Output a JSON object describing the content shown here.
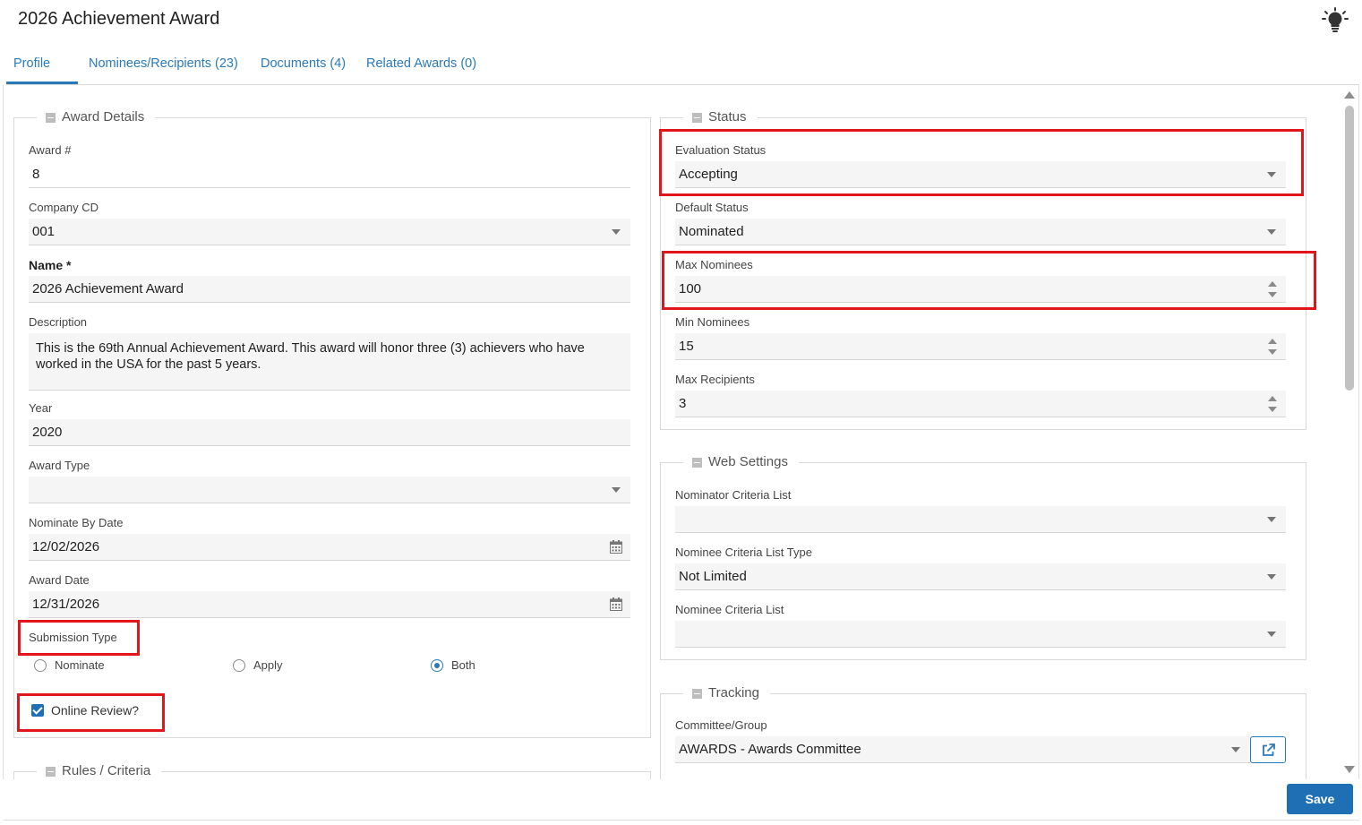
{
  "page": {
    "title": "2026 Achievement Award"
  },
  "icons": {
    "help": "lightbulb-icon"
  },
  "tabs": [
    {
      "label": "Profile",
      "active": true
    },
    {
      "label": "Nominees/Recipients (23)"
    },
    {
      "label": "Documents (4)"
    },
    {
      "label": "Related Awards (0)"
    }
  ],
  "award_details": {
    "legend": "Award Details",
    "award_no": {
      "label": "Award #",
      "value": "8"
    },
    "company_cd": {
      "label": "Company CD",
      "value": "001"
    },
    "name": {
      "label": "Name *",
      "value": "2026 Achievement Award"
    },
    "description": {
      "label": "Description",
      "value": "This is the 69th Annual Achievement Award. This award will honor three (3) achievers who have worked in the USA for the past 5 years."
    },
    "year": {
      "label": "Year",
      "value": "2020"
    },
    "award_type": {
      "label": "Award Type",
      "value": ""
    },
    "nominate_by_date": {
      "label": "Nominate By Date",
      "value": "12/02/2026"
    },
    "award_date": {
      "label": "Award Date",
      "value": "12/31/2026"
    },
    "submission_type": {
      "label": "Submission Type",
      "options": [
        "Nominate",
        "Apply",
        "Both"
      ],
      "selected": "Both"
    },
    "online_review": {
      "label": "Online Review?",
      "checked": true
    }
  },
  "rules": {
    "legend": "Rules / Criteria"
  },
  "status": {
    "legend": "Status",
    "evaluation_status": {
      "label": "Evaluation Status",
      "value": "Accepting"
    },
    "default_status": {
      "label": "Default Status",
      "value": "Nominated"
    },
    "max_nominees": {
      "label": "Max Nominees",
      "value": "100"
    },
    "min_nominees": {
      "label": "Min Nominees",
      "value": "15"
    },
    "max_recipients": {
      "label": "Max Recipients",
      "value": "3"
    }
  },
  "web_settings": {
    "legend": "Web Settings",
    "nominator_criteria_list": {
      "label": "Nominator Criteria List",
      "value": ""
    },
    "nominee_criteria_list_type": {
      "label": "Nominee Criteria List Type",
      "value": "Not Limited"
    },
    "nominee_criteria_list": {
      "label": "Nominee Criteria List",
      "value": ""
    }
  },
  "tracking": {
    "legend": "Tracking",
    "committee_group": {
      "label": "Committee/Group",
      "value": "AWARDS - Awards Committee"
    }
  },
  "actions": {
    "save": "Save"
  },
  "colors": {
    "accent": "#2a7ab8",
    "primary_button": "#1f6fb5",
    "highlight": "#e0161b"
  }
}
